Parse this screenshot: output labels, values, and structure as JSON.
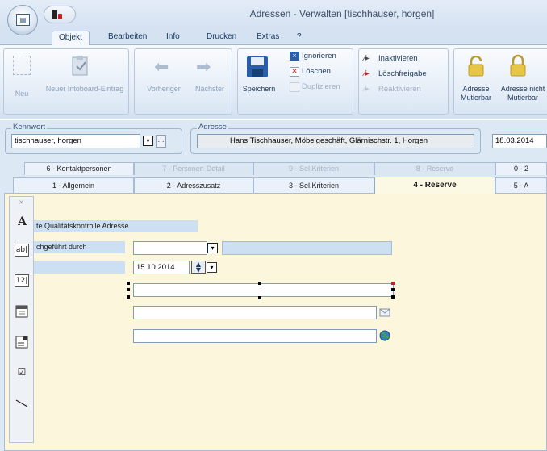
{
  "window": {
    "title": "Adressen - Verwalten [tischhauser, horgen]"
  },
  "ribbon_tabs": [
    "Objekt",
    "Bearbeiten",
    "Info",
    "Drucken",
    "Extras",
    "?"
  ],
  "ribbon": {
    "neu": "Neu",
    "neuer_intoboard": "Neuer Intoboard-Eintrag",
    "vorheriger": "Vorheriger",
    "naechster": "Nächster",
    "speichern": "Speichern",
    "ignorieren": "Ignorieren",
    "loeschen": "Löschen",
    "duplizieren": "Duplizieren",
    "inaktivieren": "Inaktivieren",
    "loeschfreigabe": "Löschfreigabe",
    "reaktivieren": "Reaktivieren",
    "adresse_mutierbar": "Adresse Mutierbar",
    "adresse_nicht_mutierbar": "Adresse nicht Mutierbar"
  },
  "search": {
    "kennwort_label": "Kennwort",
    "kennwort_value": "tischhauser, horgen",
    "adresse_label": "Adresse",
    "adresse_value": "Hans Tischhauser, Möbelgeschäft, Glärnischstr. 1, Horgen",
    "date_value": "18.03.2014"
  },
  "detail_tabs_row1": [
    "6 - Kontaktpersonen",
    "7 - Personen-Detail",
    "9 - Sel.Kriterien",
    "8 - Reserve",
    "0 - 2"
  ],
  "detail_tabs_row2": [
    "1 - Allgemein",
    "2 - Adresszusatz",
    "3 - Sel.Kriterien",
    "4 - Reserve",
    "5 - A"
  ],
  "form": {
    "heading_label": "te Qualitätskontrolle Adresse",
    "durchgefuehrt_label": "chgeführt durch",
    "date_value": "15.10.2014",
    "field3_value": "",
    "field4_value": "",
    "field5_value": ""
  },
  "toolbox_items": [
    "A",
    "ab|",
    "12|"
  ]
}
